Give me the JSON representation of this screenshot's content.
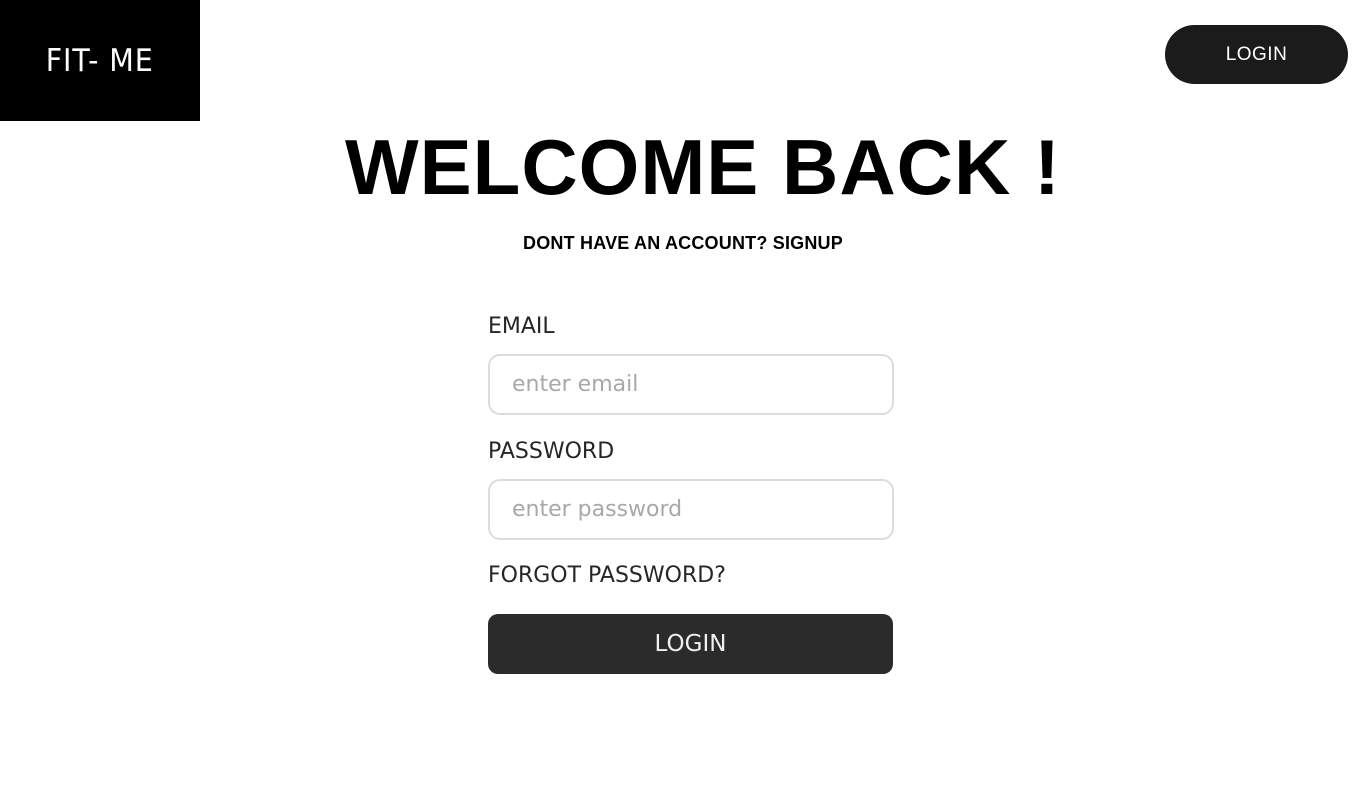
{
  "header": {
    "logo_text": "FIT- ME",
    "login_button_label": "LOGIN"
  },
  "main": {
    "title": "WELCOME BACK !",
    "signup_prompt": "DONT HAVE AN ACCOUNT?",
    "signup_link_label": "SIGNUP"
  },
  "form": {
    "email": {
      "label": "EMAIL",
      "placeholder": "enter email",
      "value": ""
    },
    "password": {
      "label": "PASSWORD",
      "placeholder": "enter password",
      "value": ""
    },
    "forgot_password_label": "FORGOT PASSWORD?",
    "submit_label": "LOGIN"
  },
  "colors": {
    "logo_background": "#000000",
    "nav_button_background": "#1b1b1b",
    "submit_button_background": "#2b2b2b",
    "input_border": "#dcdcdc",
    "placeholder_text": "#a8a8a8"
  }
}
